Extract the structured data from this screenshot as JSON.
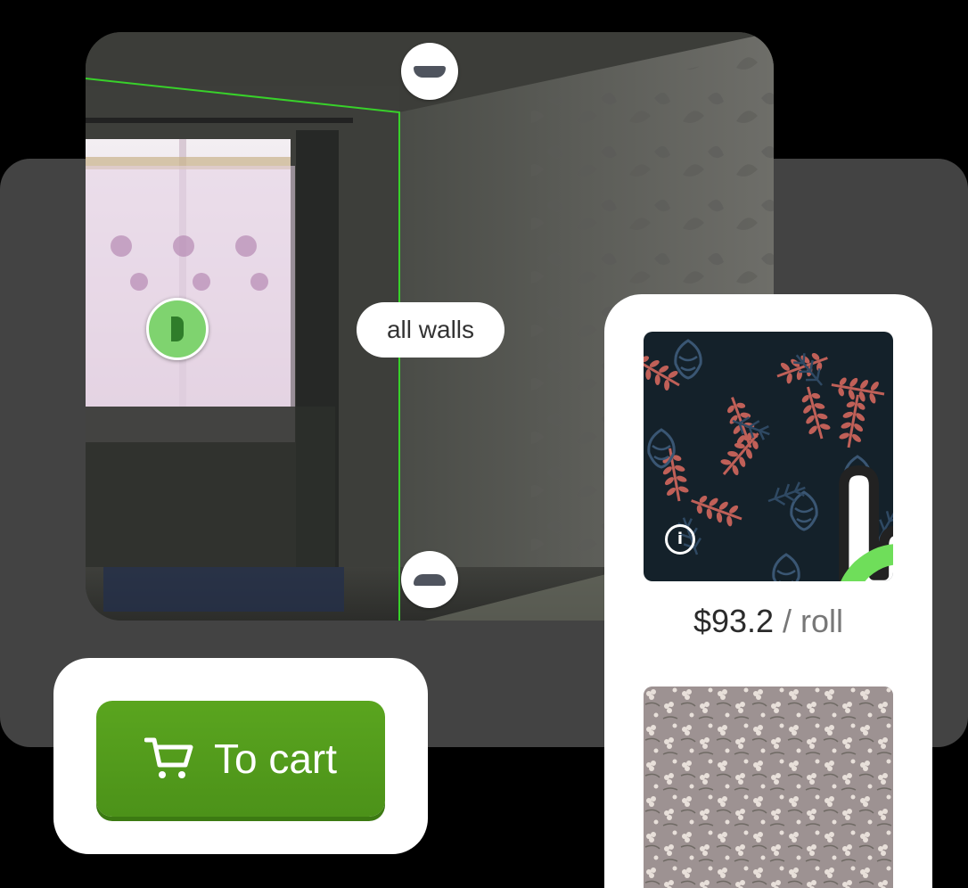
{
  "room_view": {
    "wall_selector_label": "all walls"
  },
  "cart": {
    "button_label": "To cart"
  },
  "product": {
    "price": "$93.2",
    "unit": " / roll",
    "info_icon_glyph": "i"
  },
  "colors": {
    "accent_green": "#4c9219",
    "pin_green": "#7fd36f",
    "heart_green": "#6fde5a",
    "swatch_dark": "#14212a"
  }
}
